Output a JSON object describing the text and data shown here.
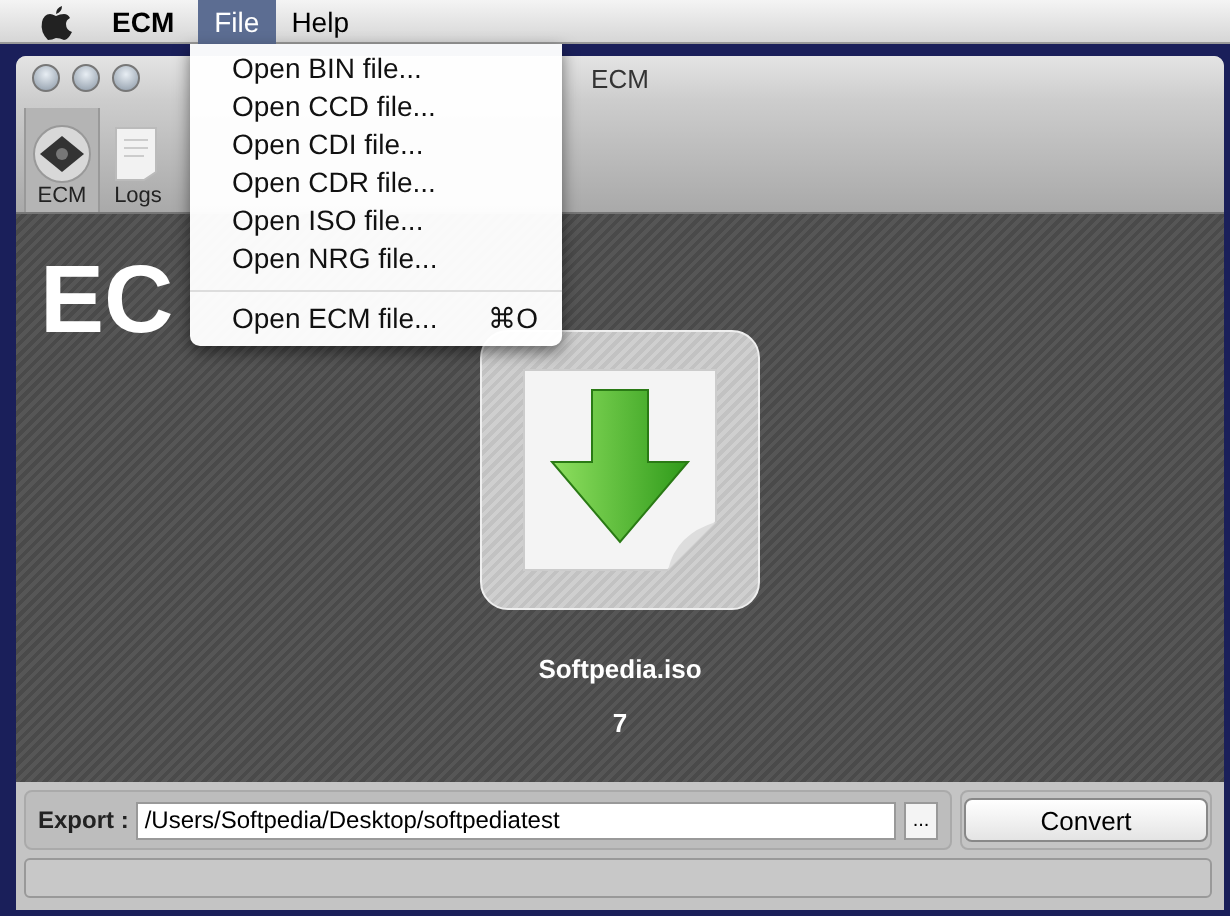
{
  "menu_bar": {
    "app_name": "ECM",
    "menus": [
      {
        "label": "File",
        "selected": true
      },
      {
        "label": "Help",
        "selected": false
      }
    ]
  },
  "open_menu": {
    "items": [
      {
        "kind": "item",
        "label": "Open BIN file..."
      },
      {
        "kind": "item",
        "label": "Open CCD file..."
      },
      {
        "kind": "item",
        "label": "Open CDI file..."
      },
      {
        "kind": "item",
        "label": "Open CDR file..."
      },
      {
        "kind": "item",
        "label": "Open ISO file..."
      },
      {
        "kind": "item",
        "label": "Open NRG file..."
      },
      {
        "kind": "separator"
      },
      {
        "kind": "item",
        "label": "Open ECM file...",
        "shortcut": "⌘O"
      }
    ]
  },
  "window": {
    "title": "ECM"
  },
  "toolbar": [
    {
      "label": "ECM",
      "selected": true
    },
    {
      "label": "Logs",
      "selected": false
    }
  ],
  "banner": {
    "title": "EC"
  },
  "file": {
    "name": "Softpedia.iso",
    "count": "7"
  },
  "export": {
    "label": "Export :",
    "value": "/Users/Softpedia/Desktop/softpediatest",
    "browse": "...",
    "convert": "Convert"
  },
  "progress": {
    "level": 0
  }
}
